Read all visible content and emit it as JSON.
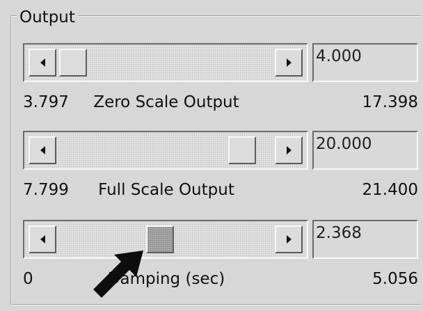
{
  "group": {
    "title": "Output"
  },
  "rows": [
    {
      "value": "4.000",
      "min": "3.797",
      "label": "Zero Scale Output",
      "max": "17.398",
      "level": 0.015
    },
    {
      "value": "20.000",
      "min": "7.799",
      "label": "Full Scale Output",
      "max": "21.400",
      "level": 0.9
    },
    {
      "value": "2.368",
      "min": "0",
      "label": "Damping (sec)",
      "max": "5.056",
      "level": 0.47
    }
  ],
  "icons": {
    "scroll_left": "left-arrow-icon",
    "scroll_right": "right-arrow-icon",
    "pointer": "mouse-pointer-icon"
  },
  "colors": {
    "panel": "#d7d7d7",
    "active_thumb": "#a9a9a9",
    "text": "#111111"
  }
}
